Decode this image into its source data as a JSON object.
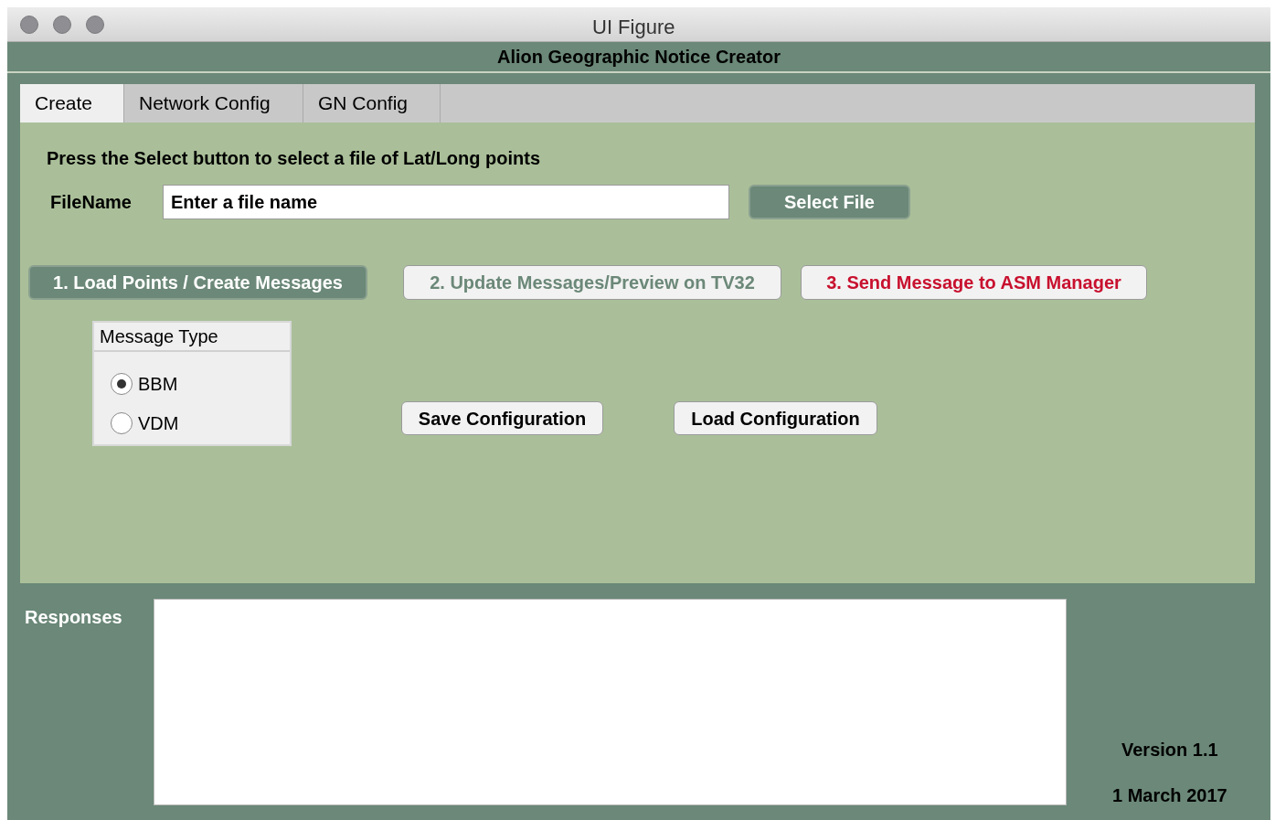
{
  "window": {
    "title": "UI Figure"
  },
  "header": "Alion Geographic Notice Creator",
  "tabs": [
    {
      "label": "Create",
      "selected": true
    },
    {
      "label": "Network Config",
      "selected": false
    },
    {
      "label": "GN Config",
      "selected": false
    }
  ],
  "instruction": "Press the Select button to select a file of Lat/Long points",
  "file": {
    "label": "FileName",
    "value": "Enter a file name",
    "button": "Select File"
  },
  "action_buttons": [
    {
      "label": "1. Load Points / Create Messages",
      "kind": "primary"
    },
    {
      "label": "2. Update Messages/Preview on TV32",
      "kind": "muted"
    },
    {
      "label": "3. Send Message to ASM Manager",
      "kind": "alert"
    }
  ],
  "message_type": {
    "title": "Message Type",
    "options": [
      {
        "label": "BBM",
        "selected": true
      },
      {
        "label": "VDM",
        "selected": false
      }
    ]
  },
  "config_buttons": [
    "Save Configuration",
    "Load Configuration"
  ],
  "responses": {
    "label": "Responses"
  },
  "version": "Version 1.1",
  "date": "1 March 2017"
}
